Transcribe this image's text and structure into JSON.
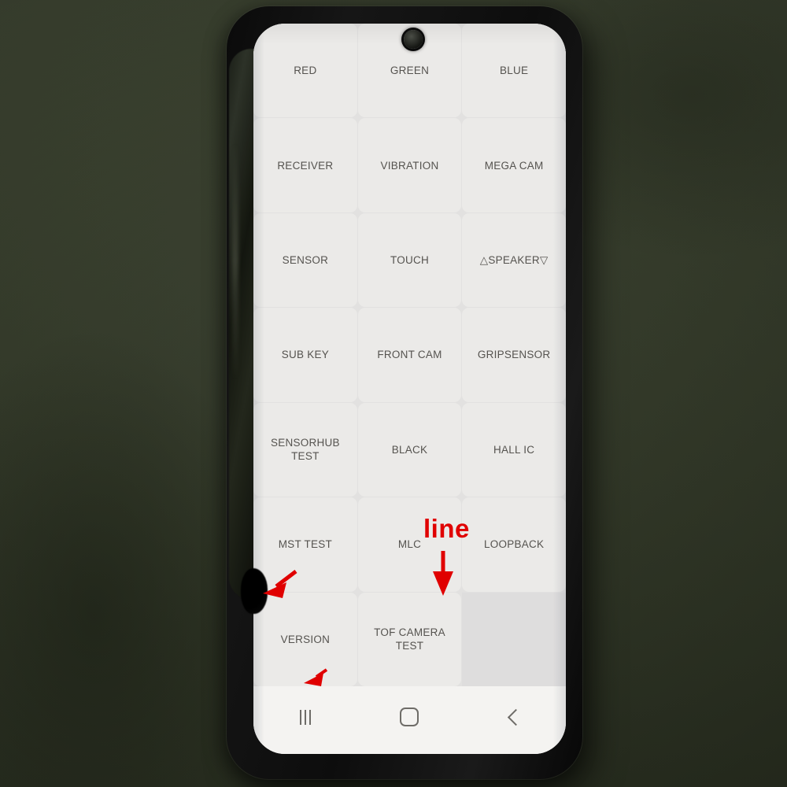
{
  "scene": {
    "description": "photo-of-phone-running-factory-test-menu",
    "backdrop_color": "#343b29",
    "phone_body_color": "#101010"
  },
  "device": {
    "screen_bg": "#f2f1ef",
    "punch_hole_camera": "front-camera-punch-hole"
  },
  "test_menu": {
    "tile_bg": "#ebeae8",
    "tile_text_color": "#55534f",
    "empty_tile_bg": "#dedddd",
    "columns": 3,
    "rows": 7,
    "tiles": [
      {
        "label": "RED",
        "empty": false
      },
      {
        "label": "GREEN",
        "empty": false
      },
      {
        "label": "BLUE",
        "empty": false
      },
      {
        "label": "RECEIVER",
        "empty": false
      },
      {
        "label": "VIBRATION",
        "empty": false
      },
      {
        "label": "MEGA CAM",
        "empty": false
      },
      {
        "label": "SENSOR",
        "empty": false
      },
      {
        "label": "TOUCH",
        "empty": false
      },
      {
        "label": "△SPEAKER▽",
        "empty": false
      },
      {
        "label": "SUB KEY",
        "empty": false
      },
      {
        "label": "FRONT CAM",
        "empty": false
      },
      {
        "label": "GRIPSENSOR",
        "empty": false
      },
      {
        "label": "SENSORHUB TEST",
        "empty": false
      },
      {
        "label": "BLACK",
        "empty": false
      },
      {
        "label": "HALL IC",
        "empty": false
      },
      {
        "label": "MST TEST",
        "empty": false
      },
      {
        "label": "MLC",
        "empty": false
      },
      {
        "label": "LOOPBACK",
        "empty": false
      },
      {
        "label": "VERSION",
        "empty": false
      },
      {
        "label": "TOF CAMERA TEST",
        "empty": false
      },
      {
        "label": "",
        "empty": true
      }
    ]
  },
  "navbar": {
    "recents_label": "recents-button",
    "home_label": "home-button",
    "back_label": "back-button"
  },
  "annotations": {
    "color": "#e00000",
    "line_text": "line",
    "arrows": [
      {
        "name": "down-arrow-to-mlc-line",
        "direction": "down"
      },
      {
        "name": "diagonal-arrow-to-left-edge-defect",
        "direction": "down-left"
      },
      {
        "name": "small-arrow-to-version-tile",
        "direction": "down-left"
      }
    ]
  }
}
